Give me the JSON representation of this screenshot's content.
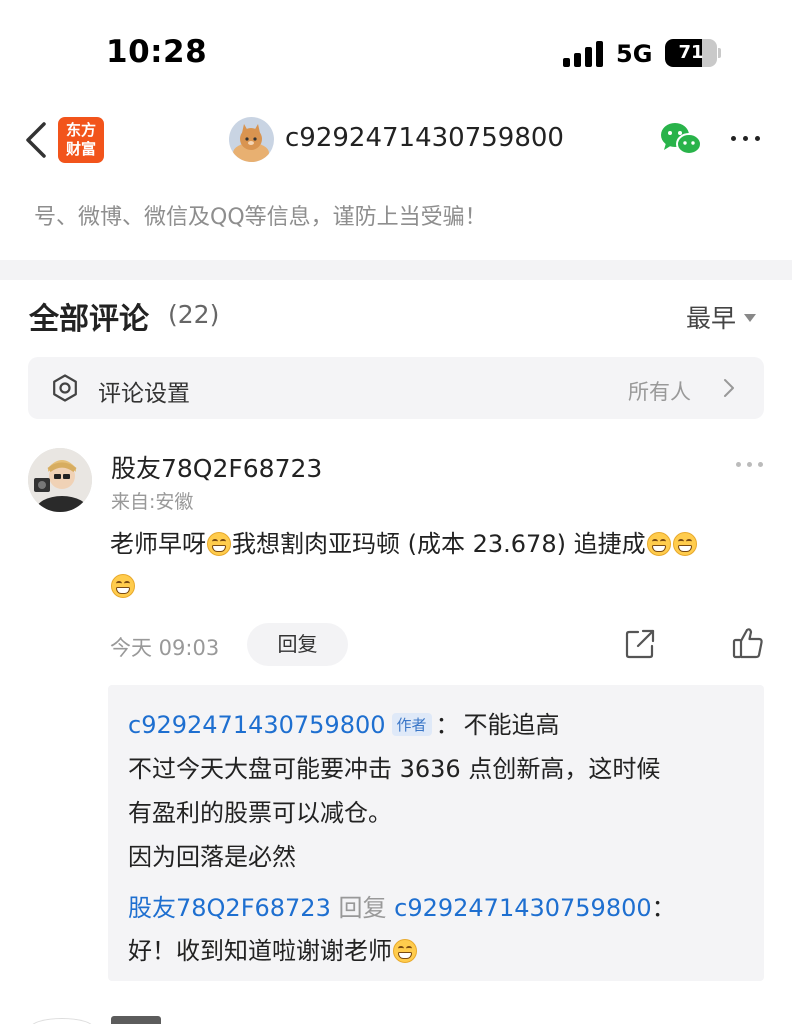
{
  "status_bar": {
    "time": "10:28",
    "network": "5G",
    "battery": "71",
    "battery_level": 0.71
  },
  "nav": {
    "logo_line1": "东方",
    "logo_line2": "财富",
    "title": "c9292471430759800"
  },
  "notice": {
    "text": "号、微博、微信及QQ等信息，谨防上当受骗！"
  },
  "comments": {
    "heading": "全部评论",
    "count": "(22)",
    "sort_label": "最早"
  },
  "settings": {
    "label": "评论设置",
    "value": "所有人"
  },
  "comment": {
    "username": "股友78Q2F68723",
    "location": "来自:安徽",
    "text_a": "老师早呀",
    "text_b": "我想割肉亚玛顿 (成本 23.678) 追捷成",
    "time": "今天 09:03",
    "reply_label": "回复"
  },
  "reply": {
    "author": "c9292471430759800",
    "author_tag": "作者",
    "colon": "：",
    "line1_text": "不能追高",
    "line2": "不过今天大盘可能要冲击 3636 点创新高，这时候",
    "line3": "有盈利的股票可以减仓。",
    "line4": "因为回落是必然",
    "sub_user": "股友78Q2F68723",
    "sub_reply_word": " 回复 ",
    "sub_target": "c9292471430759800",
    "sub_colon": "：",
    "sub_text": "好！收到知道啦谢谢老师"
  }
}
